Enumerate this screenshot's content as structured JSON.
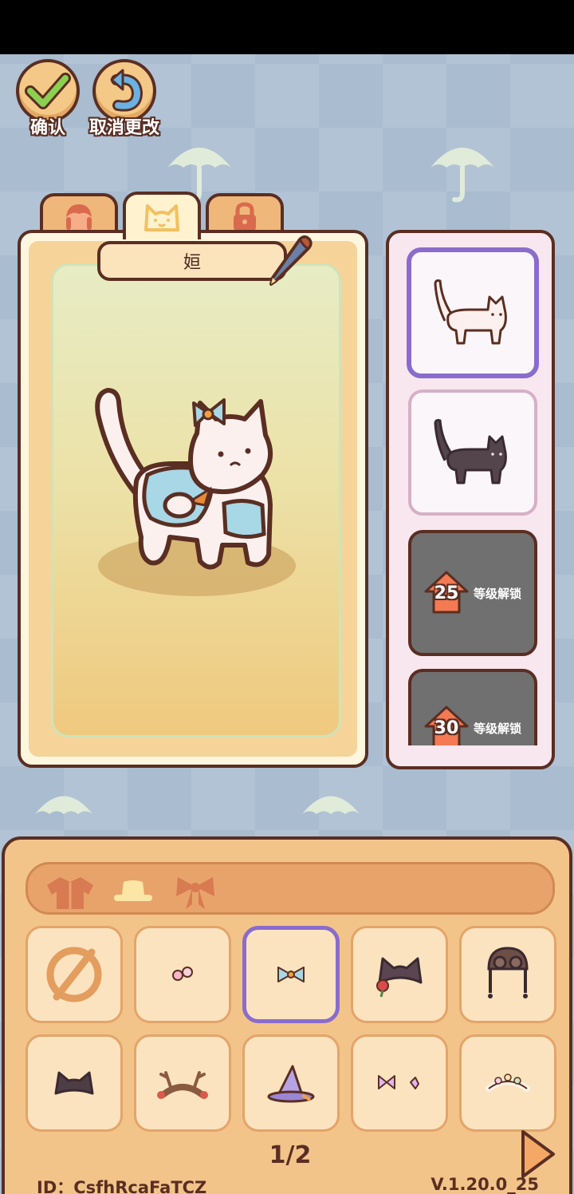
{
  "top_buttons": {
    "confirm_label": "确认",
    "cancel_label": "取消更改"
  },
  "tabs": [
    {
      "name": "face",
      "icon": "face-icon",
      "active": false
    },
    {
      "name": "cat",
      "icon": "cat-face-icon",
      "active": true
    },
    {
      "name": "locked",
      "icon": "lock-icon",
      "active": false
    }
  ],
  "pet": {
    "name": "姮"
  },
  "skins": [
    {
      "type": "white-cat",
      "selected": true,
      "locked": false
    },
    {
      "type": "black-cat",
      "selected": false,
      "locked": false
    },
    {
      "type": "locked",
      "level": "25",
      "lock_text": "等级解锁"
    },
    {
      "type": "locked",
      "level": "30",
      "lock_text": "等级解锁"
    }
  ],
  "categories": [
    {
      "name": "outfit",
      "icon": "shirt-icon",
      "active": false
    },
    {
      "name": "hat",
      "icon": "hat-icon",
      "active": true
    },
    {
      "name": "bow",
      "icon": "bow-icon",
      "active": false
    }
  ],
  "items": [
    {
      "icon": "none-icon",
      "selected": false
    },
    {
      "icon": "flower-clip-icon",
      "selected": false
    },
    {
      "icon": "blue-bow-icon",
      "selected": true
    },
    {
      "icon": "cat-ears-rose-icon",
      "selected": false
    },
    {
      "icon": "aviator-cap-icon",
      "selected": false
    },
    {
      "icon": "cat-ears-icon",
      "selected": false
    },
    {
      "icon": "antler-headband-icon",
      "selected": false
    },
    {
      "icon": "witch-hat-icon",
      "selected": false
    },
    {
      "icon": "purple-bows-icon",
      "selected": false
    },
    {
      "icon": "flower-crown-icon",
      "selected": false
    }
  ],
  "pagination": {
    "label": "1/2"
  },
  "footer": {
    "id_text": "ID：CsfhRcaFaTCZ",
    "version": "V.1.20.0_25"
  },
  "colors": {
    "outline": "#5a2e22",
    "selection": "#8a6ccd",
    "panel": "#f3c48a",
    "background": "#a9bcd0"
  }
}
